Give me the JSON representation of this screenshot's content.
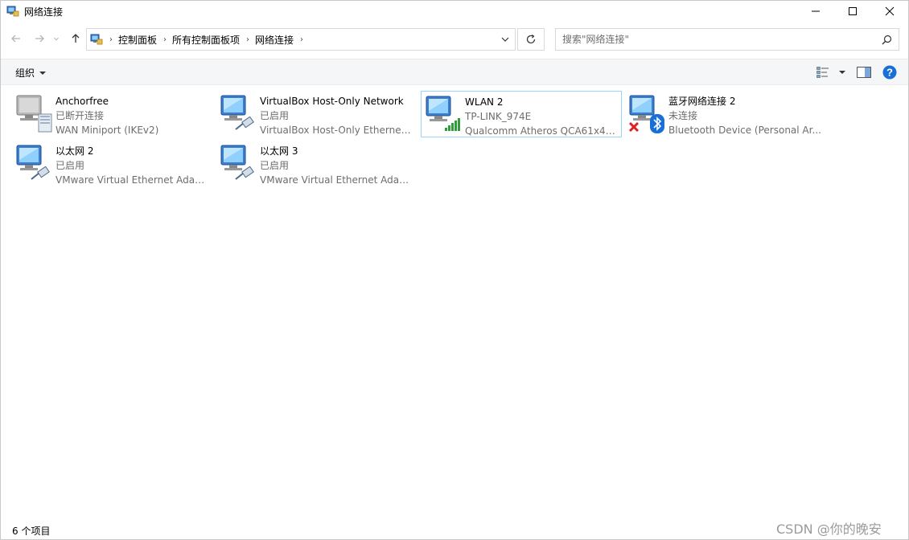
{
  "window": {
    "title": "网络连接"
  },
  "address": {
    "crumbs": [
      "控制面板",
      "所有控制面板项",
      "网络连接"
    ]
  },
  "search": {
    "placeholder": "搜索\"网络连接\""
  },
  "toolbar": {
    "organize_label": "组织"
  },
  "connections": [
    {
      "name": "Anchorfree",
      "status": "已断开连接",
      "device": "WAN Miniport (IKEv2)",
      "badge": "wan-device-icon"
    },
    {
      "name": "VirtualBox Host-Only Network",
      "status": "已启用",
      "device": "VirtualBox Host-Only Ethernet ...",
      "badge": "ethernet-cable-icon"
    },
    {
      "name": "WLAN 2",
      "status": "TP-LINK_974E",
      "device": "Qualcomm Atheros QCA61x4A...",
      "badge": "wifi-signal-icon"
    },
    {
      "name": "蓝牙网络连接 2",
      "status": "未连接",
      "device": "Bluetooth Device (Personal Ar...",
      "badge": "bluetooth-icon"
    },
    {
      "name": "以太网 2",
      "status": "已启用",
      "device": "VMware Virtual Ethernet Adap...",
      "badge": "ethernet-cable-icon"
    },
    {
      "name": "以太网 3",
      "status": "已启用",
      "device": "VMware Virtual Ethernet Adap...",
      "badge": "ethernet-cable-icon"
    }
  ],
  "statusbar": {
    "item_count": "6 个项目"
  },
  "watermark": "CSDN @你的晚安",
  "colors": {
    "selection_border": "#99d1ff",
    "help_blue": "#1a6fd6",
    "signal_green": "#2f9e3a",
    "disconnect_red": "#e02020"
  }
}
